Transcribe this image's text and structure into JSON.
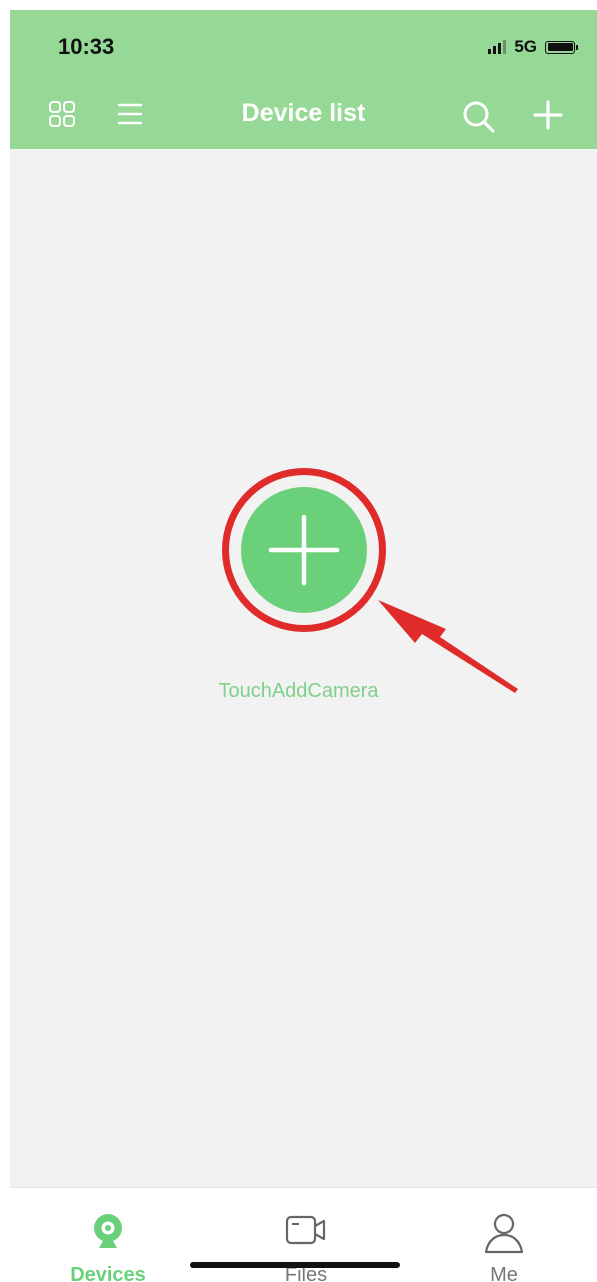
{
  "status_bar": {
    "time": "10:33",
    "network": "5G"
  },
  "header": {
    "title": "Device list"
  },
  "icons": {
    "grid_view": "grid-icon",
    "list_view": "list-icon",
    "search": "search-icon",
    "add": "plus-icon"
  },
  "main": {
    "add_label": "TouchAddCamera"
  },
  "tabs": [
    {
      "label": "Devices",
      "icon": "camera-icon",
      "active": true
    },
    {
      "label": "Files",
      "icon": "video-file-icon",
      "active": false
    },
    {
      "label": "Me",
      "icon": "person-icon",
      "active": false
    }
  ],
  "colors": {
    "header": "#96d896",
    "accent": "#6bd07a",
    "annotation": "#e02b2b",
    "background": "#f2f2f2"
  }
}
